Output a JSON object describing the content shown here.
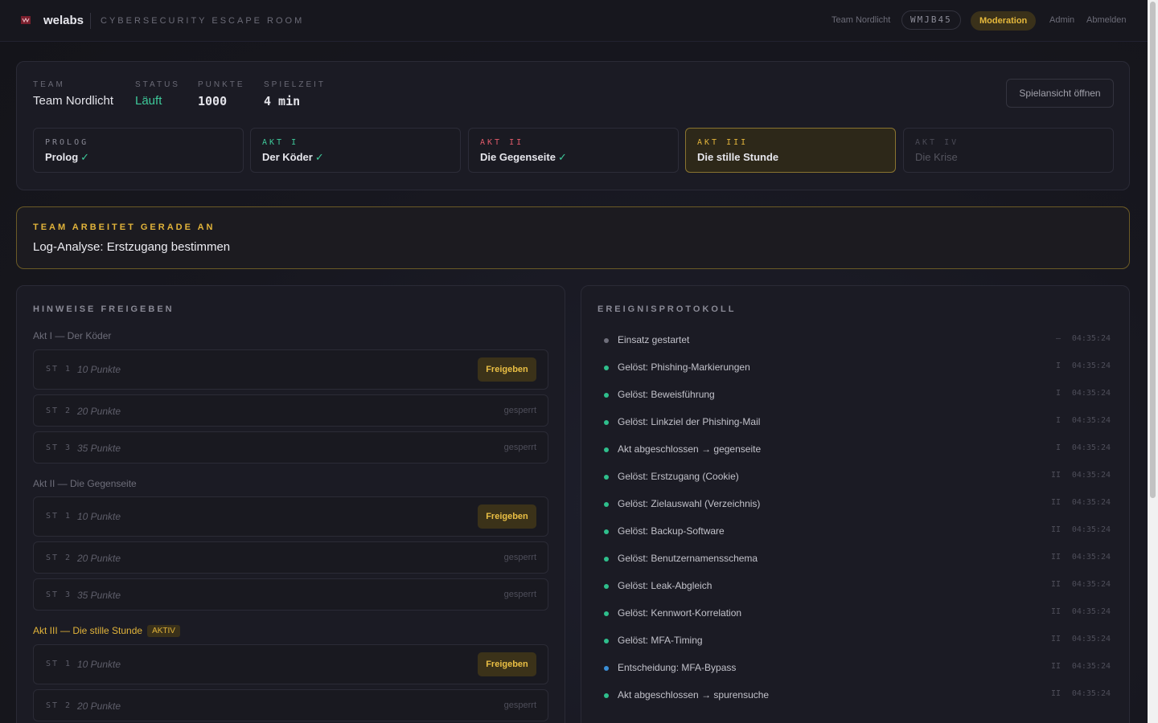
{
  "header": {
    "brand": "welabs",
    "subtitle": "CYBERSECURITY ESCAPE ROOM",
    "team": "Team Nordlicht",
    "code": "WMJB45",
    "moderation": "Moderation",
    "admin": "Admin",
    "logout": "Abmelden"
  },
  "summary": {
    "team_label": "TEAM",
    "team_value": "Team Nordlicht",
    "status_label": "STATUS",
    "status_value": "Läuft",
    "points_label": "PUNKTE",
    "points_value": "1000",
    "time_label": "SPIELZEIT",
    "time_value": "4 min",
    "open_view": "Spielansicht öffnen"
  },
  "acts": [
    {
      "key": "PROLOG",
      "name": "Prolog",
      "done": "✓"
    },
    {
      "key": "AKT I",
      "name": "Der Köder",
      "done": "✓"
    },
    {
      "key": "AKT II",
      "name": "Die Gegenseite",
      "done": "✓"
    },
    {
      "key": "AKT III",
      "name": "Die stille Stunde",
      "done": ""
    },
    {
      "key": "AKT IV",
      "name": "Die Krise",
      "done": ""
    }
  ],
  "current": {
    "label": "TEAM ARBEITET GERADE AN",
    "value": "Log-Analyse: Erstzugang bestimmen"
  },
  "hints": {
    "title": "HINWEISE FREIGEBEN",
    "release": "Freigeben",
    "locked": "gesperrt",
    "active_badge": "AKTIV",
    "groups": [
      {
        "label": "Akt I — Der Köder",
        "items": [
          {
            "st": "ST 1",
            "points": "10 Punkte"
          },
          {
            "st": "ST 2",
            "points": "20 Punkte"
          },
          {
            "st": "ST 3",
            "points": "35 Punkte"
          }
        ]
      },
      {
        "label": "Akt II — Die Gegenseite",
        "items": [
          {
            "st": "ST 1",
            "points": "10 Punkte"
          },
          {
            "st": "ST 2",
            "points": "20 Punkte"
          },
          {
            "st": "ST 3",
            "points": "35 Punkte"
          }
        ]
      },
      {
        "label": "Akt III — Die stille Stunde",
        "items": [
          {
            "st": "ST 1",
            "points": "10 Punkte"
          },
          {
            "st": "ST 2",
            "points": "20 Punkte"
          }
        ]
      }
    ]
  },
  "events": {
    "title": "EREIGNISPROTOKOLL",
    "items": [
      {
        "text": "Einsatz gestartet",
        "act": "—",
        "time": "04:35:24",
        "color": "#6e6e7a"
      },
      {
        "text": "Gelöst: Phishing-Markierungen",
        "act": "I",
        "time": "04:35:24",
        "color": "#2fbf8c"
      },
      {
        "text": "Gelöst: Beweisführung",
        "act": "I",
        "time": "04:35:24",
        "color": "#2fbf8c"
      },
      {
        "text": "Gelöst: Linkziel der Phishing-Mail",
        "act": "I",
        "time": "04:35:24",
        "color": "#2fbf8c"
      },
      {
        "text": "Akt abgeschlossen → gegenseite",
        "act": "I",
        "time": "04:35:24",
        "color": "#2fbf8c"
      },
      {
        "text": "Gelöst: Erstzugang (Cookie)",
        "act": "II",
        "time": "04:35:24",
        "color": "#2fbf8c"
      },
      {
        "text": "Gelöst: Zielauswahl (Verzeichnis)",
        "act": "II",
        "time": "04:35:24",
        "color": "#2fbf8c"
      },
      {
        "text": "Gelöst: Backup-Software",
        "act": "II",
        "time": "04:35:24",
        "color": "#2fbf8c"
      },
      {
        "text": "Gelöst: Benutzernamensschema",
        "act": "II",
        "time": "04:35:24",
        "color": "#2fbf8c"
      },
      {
        "text": "Gelöst: Leak-Abgleich",
        "act": "II",
        "time": "04:35:24",
        "color": "#2fbf8c"
      },
      {
        "text": "Gelöst: Kennwort-Korrelation",
        "act": "II",
        "time": "04:35:24",
        "color": "#2fbf8c"
      },
      {
        "text": "Gelöst: MFA-Timing",
        "act": "II",
        "time": "04:35:24",
        "color": "#2fbf8c"
      },
      {
        "text": "Entscheidung: MFA-Bypass",
        "act": "II",
        "time": "04:35:24",
        "color": "#3a8fd6"
      },
      {
        "text": "Akt abgeschlossen → spurensuche",
        "act": "II",
        "time": "04:35:24",
        "color": "#2fbf8c"
      }
    ]
  },
  "colors": {
    "accent": "#e2b43a",
    "success": "#3ec99a",
    "act_key_done": "#3ec99a",
    "act_key_prolog": "#8a8a96",
    "act_key_act2": "#e05a6a",
    "act_key_active": "#e2b43a",
    "act_key_locked": "#4a4a56"
  }
}
